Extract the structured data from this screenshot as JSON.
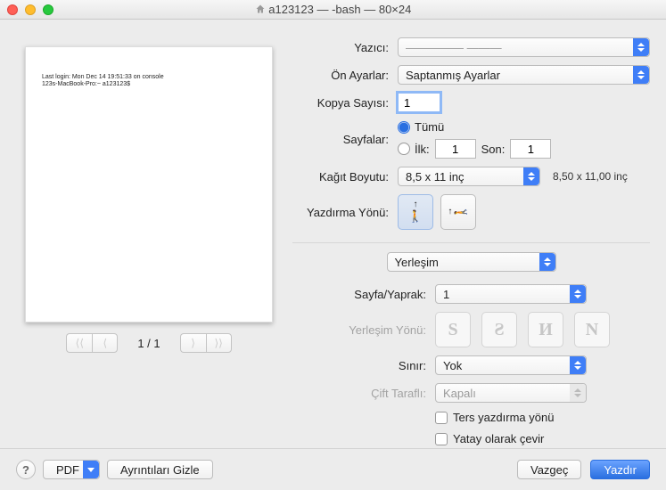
{
  "window": {
    "title": "a123123 — -bash — 80×24"
  },
  "preview": {
    "line1": "Last login: Mon Dec 14 19:51:33 on console",
    "line2": "123s-MacBook-Pro:~ a123123$",
    "page": "1 / 1"
  },
  "labels": {
    "printer": "Yazıcı:",
    "presets": "Ön Ayarlar:",
    "copies": "Kopya Sayısı:",
    "pages": "Sayfalar:",
    "all": "Tümü",
    "first": "İlk:",
    "last": "Son:",
    "paper_size": "Kağıt Boyutu:",
    "print_direction": "Yazdırma Yönü:",
    "pages_per_sheet": "Sayfa/Yaprak:",
    "layout_direction": "Yerleşim Yönü:",
    "border": "Sınır:",
    "two_sided": "Çift Taraflı:",
    "reverse": "Ters yazdırma yönü",
    "flip_h": "Yatay olarak çevir"
  },
  "values": {
    "printer": "————— ———",
    "presets": "Saptanmış Ayarlar",
    "copies": "1",
    "first": "1",
    "last": "1",
    "paper_size": "8,5 x 11 inç",
    "paper_dim": "8,50 x 11,00 inç",
    "section": "Yerleşim",
    "pages_per_sheet": "1",
    "border": "Yok",
    "two_sided": "Kapalı"
  },
  "buttons": {
    "pdf": "PDF",
    "hide_details": "Ayrıntıları Gizle",
    "cancel": "Vazgeç",
    "print": "Yazdır"
  },
  "layout_letters": [
    "S",
    "Ƨ",
    "И",
    "N"
  ]
}
